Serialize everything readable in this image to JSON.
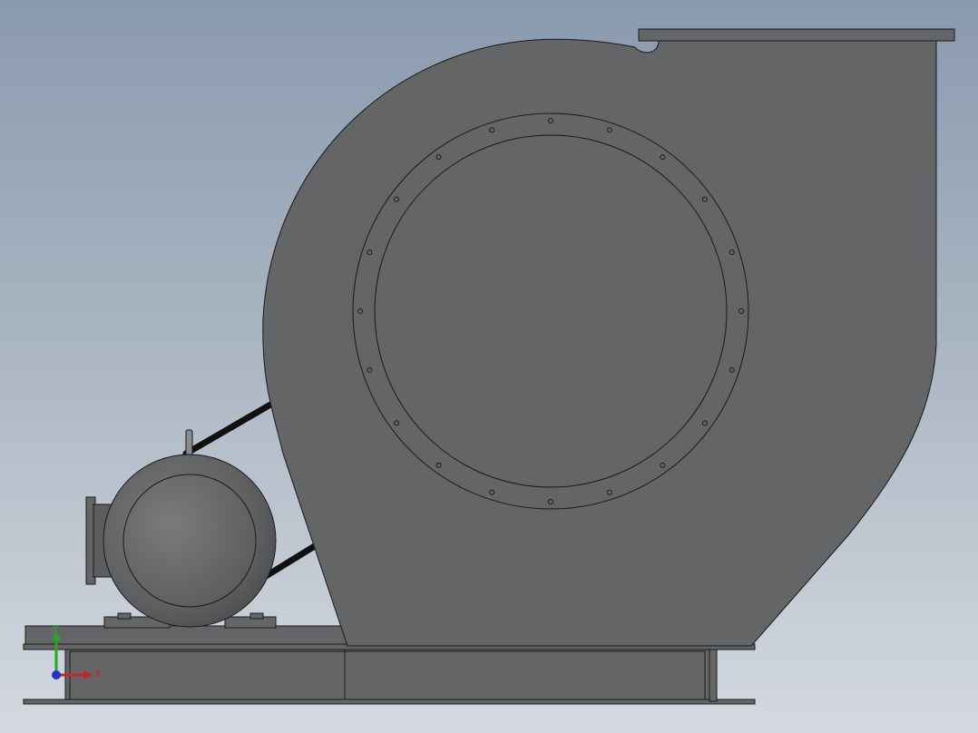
{
  "view": {
    "background_top": "#8a9aae",
    "background_bottom": "#d4d9df",
    "part_fill": "#646566",
    "edge_color": "#1a1a1a"
  },
  "triad": {
    "x_label": "X",
    "y_label": "Y",
    "x_color": "#cc2222",
    "y_color": "#22aa22",
    "z_color": "#2233cc"
  },
  "model": {
    "type": "centrifugal-fan-assembly",
    "components": [
      "fan-housing",
      "inlet-flange",
      "outlet-flange",
      "belt-drive",
      "motor",
      "base-frame"
    ],
    "inlet_bolt_count": 20
  }
}
